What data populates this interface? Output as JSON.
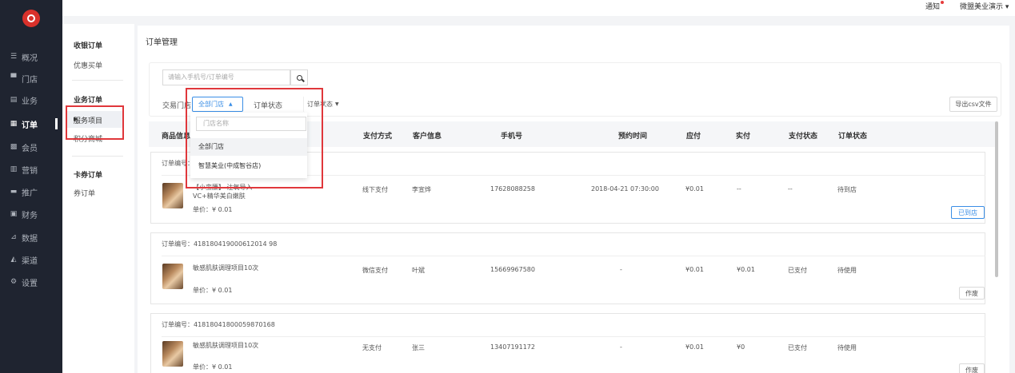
{
  "topbar": {
    "notify": "通知",
    "user": "微盟美业演示 ▾"
  },
  "nav": [
    {
      "icon": "☰",
      "label": "概况"
    },
    {
      "icon": "▀",
      "label": "门店"
    },
    {
      "icon": "▤",
      "label": "业务"
    },
    {
      "icon": "▦",
      "label": "订单"
    },
    {
      "icon": "▩",
      "label": "会员"
    },
    {
      "icon": "▥",
      "label": "营销"
    },
    {
      "icon": "▬",
      "label": "推广"
    },
    {
      "icon": "▣",
      "label": "财务"
    },
    {
      "icon": "⊿",
      "label": "数据"
    },
    {
      "icon": "◭",
      "label": "渠道"
    },
    {
      "icon": "⚙",
      "label": "设置"
    }
  ],
  "subnav": {
    "cashier_group": "收银订单",
    "offer_item": "优惠买单",
    "business_group": "业务订单",
    "service_item": "服务项目",
    "points_item": "积分商城",
    "card_group": "卡券订单",
    "coupon_item": "券订单"
  },
  "page": {
    "title": "订单管理"
  },
  "filter": {
    "search_placeholder": "请输入手机号/订单编号",
    "store_label": "交易门店",
    "store_value": "全部门店",
    "status_label": "订单状态",
    "status_value": "订单状态",
    "export_label": "导出csv文件"
  },
  "dropdown": {
    "search_placeholder": "门店名称",
    "options": [
      "全部门店",
      "智慧美业(中成智谷店)"
    ]
  },
  "table": {
    "headers": [
      "商品信息",
      "支付方式",
      "客户信息",
      "手机号",
      "预约时间",
      "应付",
      "实付",
      "支付状态",
      "订单状态"
    ]
  },
  "orders": [
    {
      "no": "订单编号：",
      "product": "【小蛮腰】 注氧导入",
      "product2": "VC+精华美白嫩肤",
      "price": "单价：¥ 0.01",
      "pay": "线下支付",
      "customer": "李宣烨",
      "phone": "17628088258",
      "time": "2018-04-21 07:30:00",
      "due": "¥0.01",
      "paid": "--",
      "pay_status": "--",
      "order_status": "待到店",
      "action": "已到店"
    },
    {
      "no": "订单编号：418180419000612014 98",
      "product": "敏感肌肤调理项目10次",
      "product2": "",
      "price": "单价：¥ 0.01",
      "pay": "微信支付",
      "customer": "叶斌",
      "phone": "15669967580",
      "time": "-",
      "due": "¥0.01",
      "paid": "¥0.01",
      "pay_status": "已支付",
      "order_status": "待使用",
      "action": "作废"
    },
    {
      "no": "订单编号：41818041800059870168",
      "product": "敏感肌肤调理项目10次",
      "product2": "",
      "price": "单价：¥ 0.01",
      "pay": "无支付",
      "customer": "张三",
      "phone": "13407191172",
      "time": "-",
      "due": "¥0.01",
      "paid": "¥0",
      "pay_status": "已支付",
      "order_status": "待使用",
      "action": "作废"
    }
  ]
}
